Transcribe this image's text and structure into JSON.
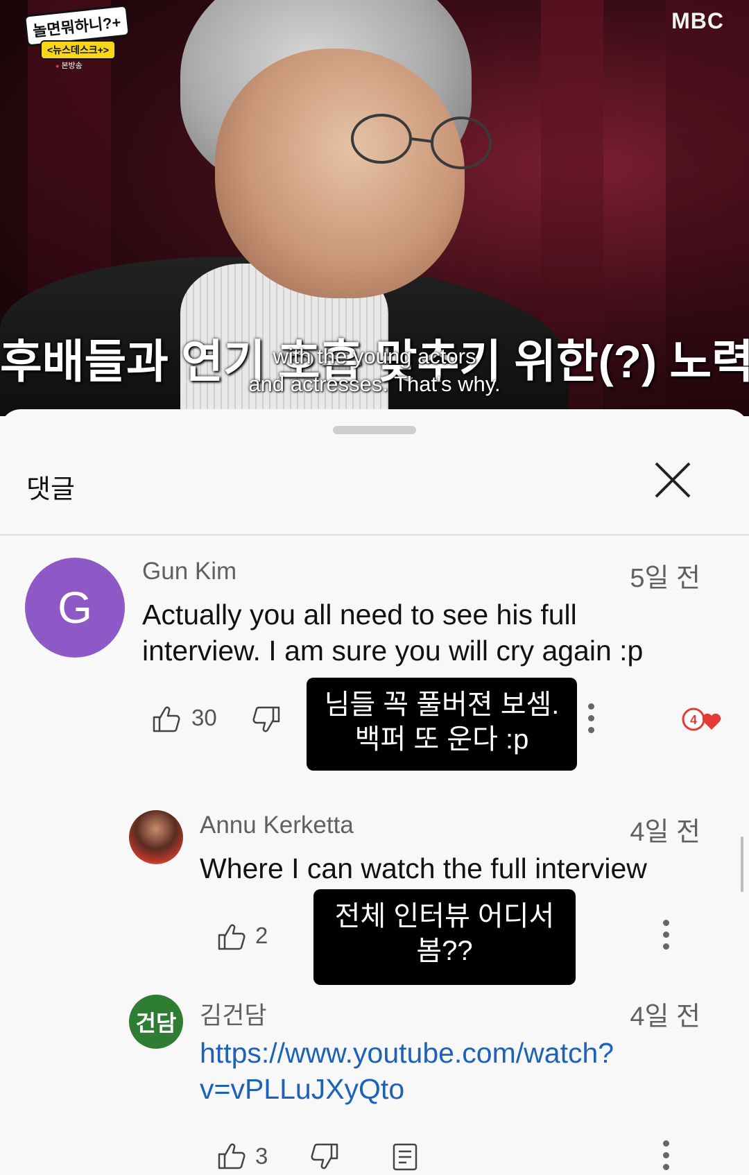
{
  "video": {
    "show_logo_title": "놀면뭐하니?+",
    "show_logo_sub": "<뉴스데스크+>",
    "show_logo_tag": "본방송",
    "broadcaster": "MBC",
    "subtitle_korean": "후배들과 연기 호흡 맞추기 위한(?) 노력",
    "subtitle_english_line1": "with the young actors",
    "subtitle_english_line2": "and actresses. That's why."
  },
  "comments_panel": {
    "title": "댓글",
    "close_icon": "close-icon"
  },
  "comments": [
    {
      "avatar_letter": "G",
      "avatar_color": "#8e58c7",
      "author": "Gun Kim",
      "time": "5일 전",
      "text_line1": "Actually you all need to see his full",
      "text_line2": "interview. I am sure you will cry again :p",
      "likes": "30",
      "caption_line1": "님들 꼭 풀버젼 보셈.",
      "caption_line2": "백퍼 또 운다 :p",
      "creator_heart": true
    },
    {
      "avatar_letter": "",
      "author": "Annu Kerketta",
      "time": "4일 전",
      "text_line1": "Where I can watch the full interview",
      "likes": "2",
      "caption_line1": "전체 인터뷰 어디서",
      "caption_line2": "봄??"
    },
    {
      "avatar_letter": "건담",
      "avatar_color": "#2e7d32",
      "author": "김건담",
      "time": "4일 전",
      "link_line1": "https://www.youtube.com/watch?",
      "link_line2": "v=vPLLuJXyQto",
      "likes": "3"
    }
  ]
}
